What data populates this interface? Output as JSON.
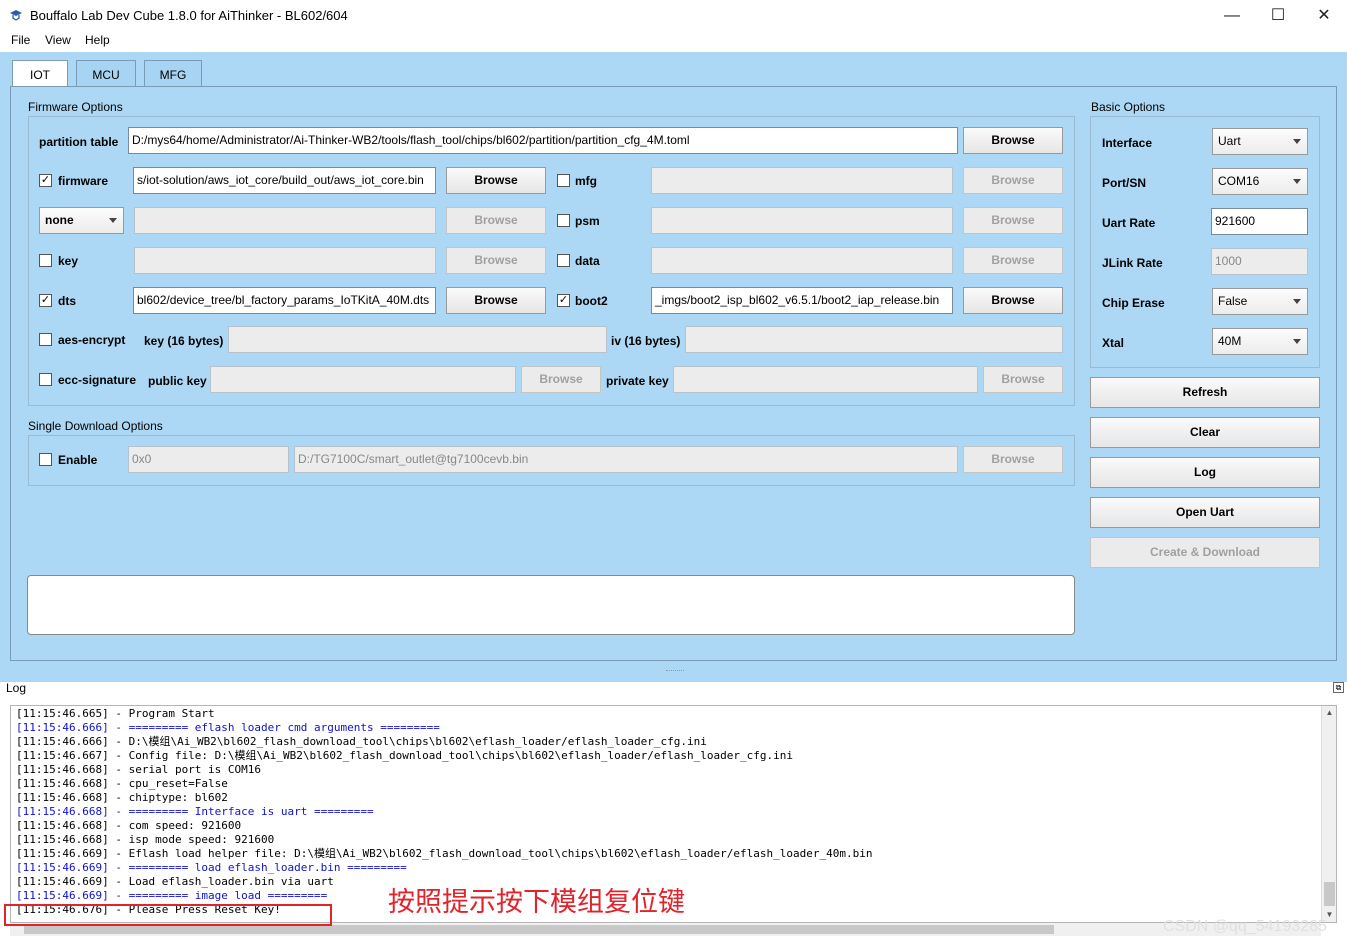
{
  "window": {
    "title": "Bouffalo Lab Dev Cube 1.8.0 for AiThinker - BL602/604",
    "minimize": "—",
    "maximize": "☐",
    "close": "✕"
  },
  "menu": {
    "file": "File",
    "view": "View",
    "help": "Help"
  },
  "tabs": [
    {
      "label": "IOT"
    },
    {
      "label": "MCU"
    },
    {
      "label": "MFG"
    }
  ],
  "firmware_options": {
    "title": "Firmware Options",
    "partition_label": "partition table",
    "partition_value": "D:/mys64/home/Administrator/Ai-Thinker-WB2/tools/flash_tool/chips/bl602/partition/partition_cfg_4M.toml",
    "browse": "Browse",
    "firmware_label": "firmware",
    "firmware_value": "s/iot-solution/aws_iot_core/build_out/aws_iot_core.bin",
    "mfg_label": "mfg",
    "none_option": "none",
    "psm_label": "psm",
    "key_label": "key",
    "data_label": "data",
    "dts_label": "dts",
    "dts_value": "bl602/device_tree/bl_factory_params_IoTKitA_40M.dts",
    "boot2_label": "boot2",
    "boot2_value": "_imgs/boot2_isp_bl602_v6.5.1/boot2_iap_release.bin",
    "aes_label": "aes-encrypt",
    "key16_label": "key (16 bytes)",
    "iv16_label": "iv (16 bytes)",
    "ecc_label": "ecc-signature",
    "public_key_label": "public key",
    "private_key_label": "private key",
    "check": "✓"
  },
  "single_download": {
    "title": "Single Download Options",
    "enable_label": "Enable",
    "address_placeholder": "0x0",
    "path_placeholder": "D:/TG7100C/smart_outlet@tg7100cevb.bin",
    "browse": "Browse"
  },
  "basic_options": {
    "title": "Basic Options",
    "interface_label": "Interface",
    "interface_value": "Uart",
    "port_label": "Port/SN",
    "port_value": "COM16",
    "uart_rate_label": "Uart Rate",
    "uart_rate_value": "921600",
    "jlink_rate_label": "JLink Rate",
    "jlink_rate_value": "1000",
    "chip_erase_label": "Chip Erase",
    "chip_erase_value": "False",
    "xtal_label": "Xtal",
    "xtal_value": "40M"
  },
  "actions": {
    "refresh": "Refresh",
    "clear": "Clear",
    "log": "Log",
    "open_uart": "Open Uart",
    "create_download": "Create & Download"
  },
  "log": {
    "label": "Log",
    "lines": [
      {
        "text": "[11:15:46.665] - Program Start",
        "blue": false
      },
      {
        "text": "[11:15:46.666] - ========= eflash loader cmd arguments =========",
        "blue": true
      },
      {
        "text": "[11:15:46.666] - D:\\模组\\Ai_WB2\\bl602_flash_download_tool\\chips\\bl602\\eflash_loader/eflash_loader_cfg.ini",
        "blue": false
      },
      {
        "text": "[11:15:46.667] - Config file: D:\\模组\\Ai_WB2\\bl602_flash_download_tool\\chips\\bl602\\eflash_loader/eflash_loader_cfg.ini",
        "blue": false
      },
      {
        "text": "[11:15:46.668] - serial port is COM16",
        "blue": false
      },
      {
        "text": "[11:15:46.668] - cpu_reset=False",
        "blue": false
      },
      {
        "text": "[11:15:46.668] - chiptype: bl602",
        "blue": false
      },
      {
        "text": "[11:15:46.668] - ========= Interface is uart =========",
        "blue": true
      },
      {
        "text": "[11:15:46.668] - com speed: 921600",
        "blue": false
      },
      {
        "text": "[11:15:46.668] - isp mode speed: 921600",
        "blue": false
      },
      {
        "text": "[11:15:46.669] - Eflash load helper file: D:\\模组\\Ai_WB2\\bl602_flash_download_tool\\chips\\bl602\\eflash_loader/eflash_loader_40m.bin",
        "blue": false
      },
      {
        "text": "[11:15:46.669] - ========= load eflash_loader.bin =========",
        "blue": true
      },
      {
        "text": "[11:15:46.669] - Load eflash_loader.bin via uart",
        "blue": false
      },
      {
        "text": "[11:15:46.669] - ========= image load =========",
        "blue": true
      },
      {
        "text": "[11:15:46.676] - Please Press Reset Key!",
        "blue": false
      }
    ]
  },
  "annotation": "按照提示按下模组复位键",
  "watermark": "CSDN @qq_54193285"
}
